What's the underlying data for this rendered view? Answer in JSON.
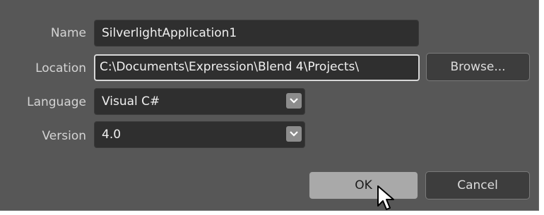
{
  "form": {
    "name_label": "Name",
    "name_value": "SilverlightApplication1",
    "location_label": "Location",
    "location_value": "C:\\Documents\\Expression\\Blend 4\\Projects\\",
    "language_label": "Language",
    "language_value": "Visual C#",
    "version_label": "Version",
    "version_value": "4.0"
  },
  "buttons": {
    "browse": "Browse...",
    "ok": "OK",
    "cancel": "Cancel"
  },
  "icons": {
    "dropdown": "chevron-down-icon",
    "cursor": "mouse-pointer-icon"
  }
}
